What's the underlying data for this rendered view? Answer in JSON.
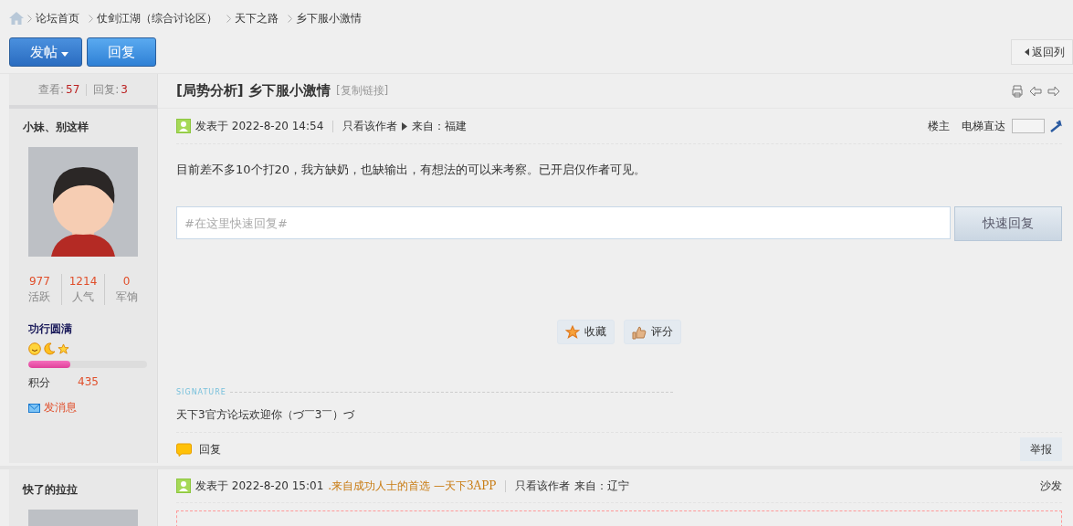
{
  "breadcrumb": [
    "论坛首页",
    "仗剑江湖（综合讨论区）",
    "天下之路",
    "乡下服小激情"
  ],
  "toolbar": {
    "post_button": "发帖",
    "reply_button": "回复",
    "back_button": "返回列"
  },
  "thread": {
    "views_label": "查看:",
    "views": "57",
    "replies_label": "回复:",
    "replies": "3",
    "title": "[局势分析] 乡下服小激情",
    "copy_link": "[复制链接]"
  },
  "posts": [
    {
      "author": "小妹、别这样",
      "avatar": {
        "kind": "picture"
      },
      "stats": [
        {
          "value": "977",
          "label": "活跃"
        },
        {
          "value": "1214",
          "label": "人气"
        },
        {
          "value": "0",
          "label": "军饷"
        }
      ],
      "rank": "功行圆满",
      "level": 0.35,
      "points_label": "积分",
      "points": "435",
      "message_link": "发消息",
      "posted": "发表于 2022-8-20 14:54",
      "only_author": "只看该作者",
      "from": "来自：福建",
      "floor": "楼主",
      "jump_label": "电梯直达",
      "content": "目前差不多10个打20，我方缺奶，也缺输出，有想法的可以来考察。已开启仅作者可见。",
      "quick_reply": {
        "placeholder": "#在这里快速回复#",
        "button": "快速回复"
      },
      "actions": [
        "收藏",
        "评分"
      ],
      "signature_label": "SIGNATURE",
      "signature": "天下3官方论坛欢迎你（づ￣3￣）づ",
      "reply": "回复",
      "report": "举报"
    },
    {
      "author": "快了的拉拉",
      "avatar": {
        "kind": "picture"
      },
      "posted": "发表于 2022-8-20 15:01",
      "app_tag": ".来自成功人士的首选 —天下3APP",
      "only_author": "只看该作者",
      "from": "来自：辽宁",
      "floor": "沙发"
    }
  ]
}
